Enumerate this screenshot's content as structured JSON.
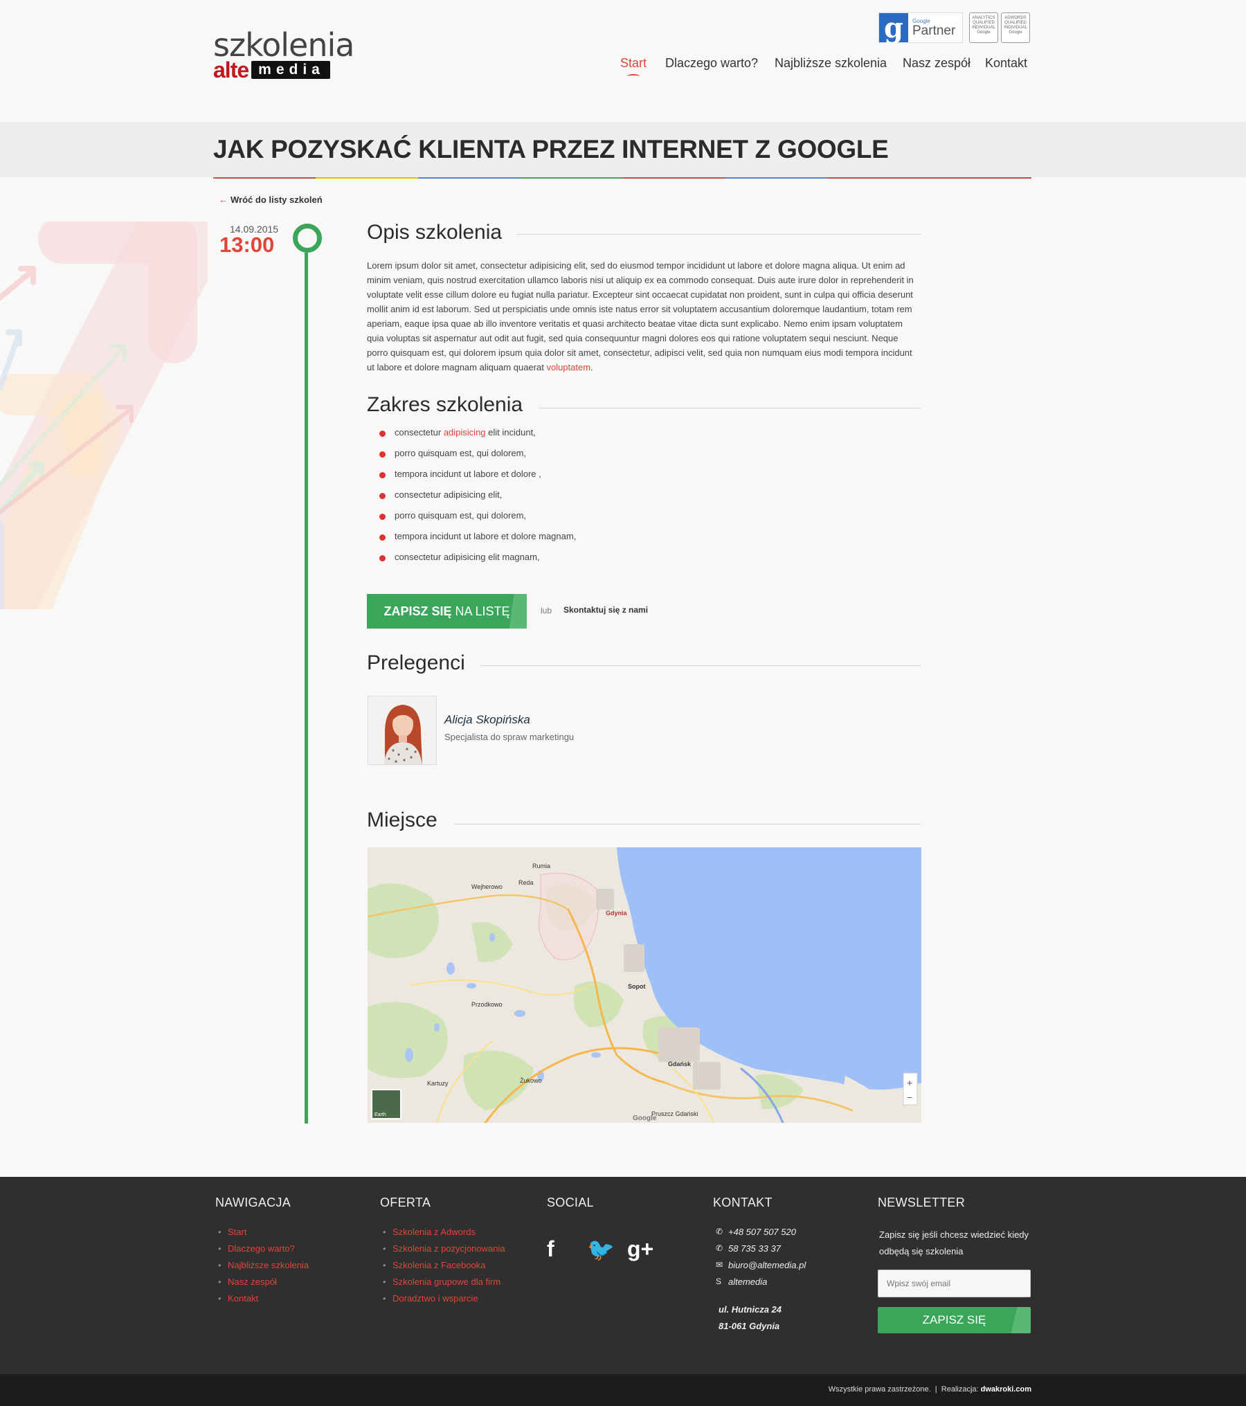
{
  "brand": {
    "logo_top": "szkolenia",
    "logo_alte": "alte",
    "logo_media": "media"
  },
  "badges": {
    "partner_small": "Google",
    "partner_big": "Partner",
    "analytics": "ANALYTICS QUALIFIED INDIVIDUAL Google",
    "adwords": "ADWORDS QUALIFIED INDIVIDUAL Google"
  },
  "nav": [
    {
      "label": "Start",
      "active": true
    },
    {
      "label": "Dlaczego warto?"
    },
    {
      "label": "Najbliższe szkolenia"
    },
    {
      "label": "Nasz zespół"
    },
    {
      "label": "Kontakt"
    }
  ],
  "page_title": "JAK POZYSKAĆ KLIENTA PRZEZ INTERNET Z GOOGLE",
  "title_line_colors": [
    "#e0453a",
    "#f4b400",
    "#4285f4",
    "#34a853",
    "#e0453a",
    "#4285f4",
    "#e0453a",
    "#e0453a"
  ],
  "back_link": "Wróć do listy szkoleń",
  "event": {
    "date": "14.09.2015",
    "time": "13:00"
  },
  "sections": {
    "description_title": "Opis szkolenia",
    "scope_title": "Zakres szkolenia",
    "speakers_title": "Prelegenci",
    "place_title": "Miejsce"
  },
  "description": {
    "text": "Lorem ipsum dolor sit amet, consectetur adipisicing elit, sed do eiusmod tempor incididunt ut labore et dolore magna aliqua. Ut enim ad minim veniam, quis nostrud exercitation ullamco laboris nisi ut aliquip ex ea commodo consequat. Duis aute irure dolor in reprehenderit in voluptate velit esse cillum dolore eu fugiat nulla pariatur. Excepteur sint occaecat cupidatat non proident, sunt in culpa qui officia deserunt mollit anim id est laborum. Sed ut perspiciatis unde omnis iste natus error sit voluptatem accusantium doloremque laudantium, totam rem aperiam, eaque ipsa quae ab illo inventore veritatis et quasi architecto beatae vitae dicta sunt explicabo. Nemo enim ipsam voluptatem quia voluptas sit aspernatur aut odit aut fugit, sed quia consequuntur magni dolores eos qui ratione voluptatem sequi nesciunt. Neque porro quisquam est, qui dolorem ipsum quia dolor sit amet, consectetur, adipisci velit, sed quia non numquam eius modi tempora incidunt ut labore et dolore magnam aliquam quaerat",
    "highlight": "voluptatem",
    "end": "."
  },
  "scope_items": [
    {
      "before": "consectetur ",
      "hl": "adipisicing",
      "after": " elit incidunt,"
    },
    {
      "before": "porro quisquam est, qui dolorem,",
      "hl": "",
      "after": ""
    },
    {
      "before": "tempora incidunt ut labore et dolore ,",
      "hl": "",
      "after": ""
    },
    {
      "before": "consectetur adipisicing elit,",
      "hl": "",
      "after": ""
    },
    {
      "before": "porro quisquam est, qui dolorem,",
      "hl": "",
      "after": ""
    },
    {
      "before": "tempora incidunt ut labore et dolore magnam,",
      "hl": "",
      "after": ""
    },
    {
      "before": "consectetur adipisicing elit magnam,",
      "hl": "",
      "after": ""
    }
  ],
  "cta": {
    "bold": "ZAPISZ SIĘ",
    "rest": " NA LISTĘ",
    "or": "lub",
    "contact": "Skontaktuj się z nami"
  },
  "speaker": {
    "name": "Alicja Skopińska",
    "role": "Specjalista do spraw marketingu"
  },
  "map": {
    "labels": [
      "Gdynia",
      "Sopot",
      "Gdańsk",
      "Rumia",
      "Reda",
      "Wejherowo",
      "Kartuzy",
      "Żukowo",
      "Pruszcz Gdański",
      "Przodkowo",
      "Earth"
    ],
    "google": "Google",
    "zoom_in": "+",
    "zoom_out": "−"
  },
  "footer": {
    "nav_title": "NAWIGACJA",
    "nav_items": [
      "Start",
      "Dlaczego warto?",
      "Najbliższe szkolenia",
      "Nasz zespół",
      "Kontakt"
    ],
    "offer_title": "OFERTA",
    "offer_items": [
      "Szkolenia z Adwords",
      "Szkolenia z pozycjonowania",
      "Szkolenia z Facebooka",
      "Szkolenia grupowe dla firm",
      "Doradztwo i wsparcie"
    ],
    "social_title": "SOCIAL",
    "social": [
      {
        "icon": "facebook-icon",
        "glyph": "f"
      },
      {
        "icon": "twitter-icon",
        "glyph": "🐦"
      },
      {
        "icon": "google-plus-icon",
        "glyph": "g+"
      }
    ],
    "contact_title": "KONTAKT",
    "contacts": [
      {
        "icon": "phone-icon",
        "glyph": "✆",
        "text": "+48 507 507 520"
      },
      {
        "icon": "phone-icon",
        "glyph": "✆",
        "text": "58 735 33 37"
      },
      {
        "icon": "mail-icon",
        "glyph": "✉",
        "text": "biuro@altemedia.pl"
      },
      {
        "icon": "skype-icon",
        "glyph": "S",
        "text": "altemedia"
      }
    ],
    "address_1": "ul. Hutnicza 24",
    "address_2": "81-061 Gdynia",
    "newsletter_title": "NEWSLETTER",
    "newsletter_text": "Zapisz się jeśli chcesz wiedzieć kiedy odbędą się szkolenia",
    "newsletter_placeholder": "Wpisz swój email",
    "newsletter_button": "ZAPISZ SIĘ"
  },
  "bottom": {
    "rights": "Wszystkie prawa zastrzeżone.",
    "sep": "|",
    "realizacja": "Realizacja:",
    "author": "dwakroki.com"
  }
}
